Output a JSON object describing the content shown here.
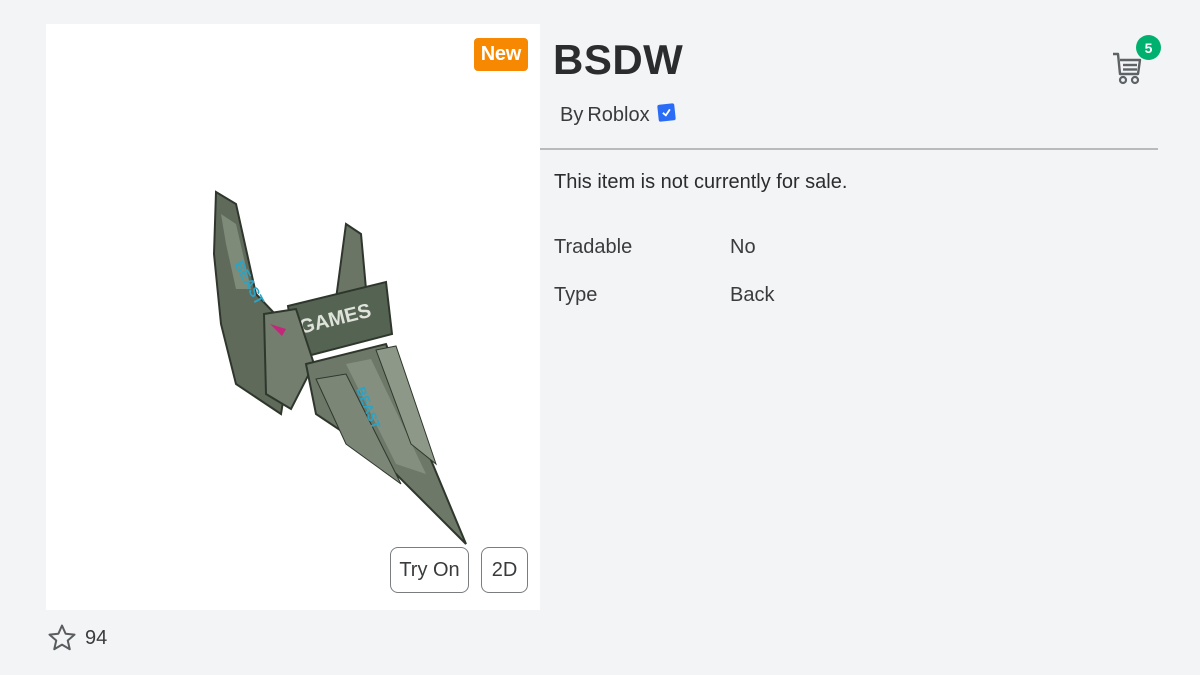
{
  "item": {
    "name": "BSDW",
    "badge": "New",
    "creator_prefix": "By",
    "creator_name": "Roblox",
    "creator_verified": true,
    "sale_status": "This item is not currently for sale.",
    "details": [
      {
        "label": "Tradable",
        "value": "No"
      },
      {
        "label": "Type",
        "value": "Back"
      }
    ],
    "favorites": "94",
    "art_label": "GAMES"
  },
  "viewer": {
    "try_on_label": "Try On",
    "view_2d_label": "2D"
  },
  "header": {
    "cart_icon": "shopping-cart-icon",
    "cart_count": "5"
  },
  "colors": {
    "badge_new": "#f68802",
    "cart_badge": "#00b06f",
    "verified": "#2a6cf6",
    "background": "#f2f4f5"
  }
}
